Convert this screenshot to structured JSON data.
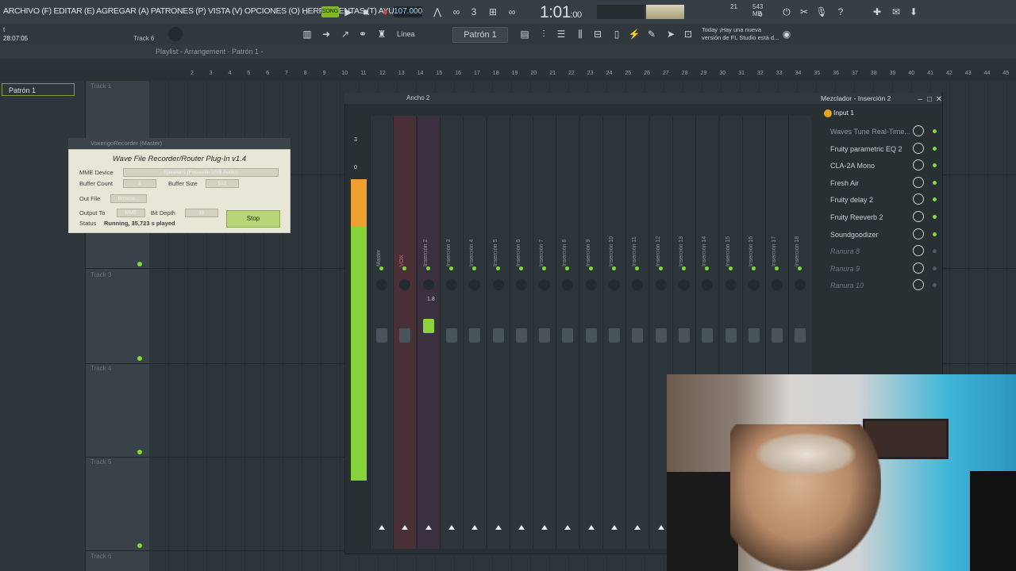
{
  "menu": "ARCHIVO (F) EDITAR (E) AGREGAR (A) PATRONES (P) VISTA (V) OPCIONES (O) HERRAMIENTAS (T) AYUDA",
  "transport": {
    "mode": "SONG",
    "tempo": "107.000",
    "time": "1:01",
    "time_small": ":00"
  },
  "cpu": {
    "memory": "543 MB",
    "voices": "21",
    "cpu_value": "0"
  },
  "news": {
    "line1": "Today  ¡Hay una nueva",
    "line2": "versión de FL Studio está d..."
  },
  "status": {
    "hint": "t",
    "elapsed": "28:07:05",
    "track": "Track 6"
  },
  "toolbar2": {
    "snap": "Línea",
    "pattern": "Patrón 1"
  },
  "playlist": {
    "title": "Playlist - Arrangement - Patrón 1 -",
    "pattern_item": "Patrón 1",
    "ruler": [
      "2",
      "3",
      "4",
      "5",
      "6",
      "7",
      "8",
      "9",
      "10",
      "11",
      "12",
      "13",
      "14",
      "15",
      "16",
      "17",
      "18",
      "19",
      "20",
      "21",
      "22",
      "23",
      "24",
      "25",
      "26",
      "27",
      "28",
      "29",
      "30",
      "31",
      "32",
      "33",
      "34",
      "35",
      "36",
      "37",
      "38",
      "39",
      "40",
      "41",
      "42",
      "43",
      "44",
      "45",
      "46"
    ],
    "tracks": [
      "Track 1",
      "Track 3",
      "Track 4",
      "Track 5",
      "Track 6"
    ]
  },
  "voxengo": {
    "window_title": "VoxengoRecorder (Master)",
    "title": "Wave File Recorder/Router Plug-In v1.4",
    "mme_device_label": "MME Device",
    "mme_device": "Speakers (Focusrite USB Audio)",
    "buffer_count_label": "Buffer Count",
    "buffer_count": "8",
    "buffer_size_label": "Buffer Size",
    "buffer_size": "512",
    "out_file_label": "Out File",
    "browse": "Browse...",
    "output_to_label": "Output To",
    "output_to": "MME",
    "bit_depth_label": "Bit Depth",
    "bit_depth": "16",
    "status_label": "Status",
    "status": "Running, 35,723 s played",
    "stop": "Stop"
  },
  "mixer": {
    "name": "Ancho 2",
    "master_levels": [
      "3",
      "0"
    ],
    "insert2_value": "1.8",
    "strips": [
      "Master",
      "VOX",
      "Inserción 2",
      "Inserción 3",
      "Inserción 4",
      "Inserción 5",
      "Inserción 6",
      "Inserción 7",
      "Inserción 8",
      "Inserción 9",
      "Inserción 10",
      "Inserción 11",
      "Inserción 12",
      "Inserción 13",
      "Inserción 14",
      "Inserción 15",
      "Inserción 16",
      "Inserción 17",
      "Inserción 18"
    ]
  },
  "mixer_panel": {
    "title": "Mezclador - Inserción 2",
    "input": "Input 1",
    "slots": [
      "Waves Tune Real-Time...",
      "Fruity parametric EQ 2",
      "CLA-2A Mono",
      "Fresh Air",
      "Fruity delay 2",
      "Fruity Reeverb 2",
      "Soundgoodizer",
      "Ranura 8",
      "Ranura 9",
      "Ranura 10"
    ]
  },
  "colors": {
    "accent_green": "#7fdc33",
    "meter_orange": "#f0a030",
    "vox_red": "#c8444e"
  }
}
